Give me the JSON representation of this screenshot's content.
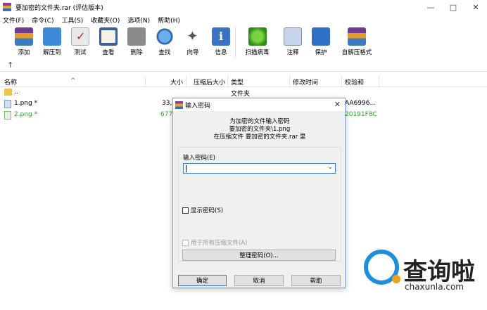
{
  "window": {
    "title": "要加密的文件夹.rar (评估版本)"
  },
  "menu": [
    "文件(F)",
    "命令(C)",
    "工具(S)",
    "收藏夹(O)",
    "选项(N)",
    "帮助(H)"
  ],
  "toolbar": [
    {
      "label": "添加",
      "icon": "add-icon"
    },
    {
      "label": "解压到",
      "icon": "extract-icon"
    },
    {
      "label": "测试",
      "icon": "test-icon"
    },
    {
      "label": "查看",
      "icon": "view-icon"
    },
    {
      "label": "删除",
      "icon": "delete-icon"
    },
    {
      "label": "查找",
      "icon": "find-icon"
    },
    {
      "label": "向导",
      "icon": "wizard-icon"
    },
    {
      "label": "信息",
      "icon": "info-icon"
    },
    {
      "label": "扫描病毒",
      "icon": "virus-scan-icon"
    },
    {
      "label": "注释",
      "icon": "comment-icon"
    },
    {
      "label": "保护",
      "icon": "protect-icon"
    },
    {
      "label": "自解压格式",
      "icon": "sfx-icon"
    }
  ],
  "columns": [
    "名称",
    "大小",
    "压缩后大小",
    "类型",
    "修改时间",
    "校验和"
  ],
  "files": [
    {
      "name": "..",
      "size": "",
      "type": "文件夹",
      "checksum": ""
    },
    {
      "name": "1.png *",
      "size": "33,",
      "type": "",
      "checksum": "AA6996..."
    },
    {
      "name": "2.png *",
      "size": "677,",
      "type": "",
      "checksum": "20191F8C"
    }
  ],
  "dialog": {
    "title": "输入密码",
    "info_line1": "为加密的文件输入密码",
    "info_line2": "要加密的文件夹\\1.png",
    "info_line3": "在压缩文件 要加密的文件夹.rar 里",
    "password_label": "输入密码(E)",
    "password_value": "",
    "show_password": "显示密码(S)",
    "use_for_all": "用于所有压缩文件(A)",
    "organize": "整理密码(O)...",
    "ok": "确定",
    "cancel": "取消",
    "help": "帮助"
  },
  "watermark": {
    "text": "查询啦",
    "url": "chaxunla.com"
  }
}
